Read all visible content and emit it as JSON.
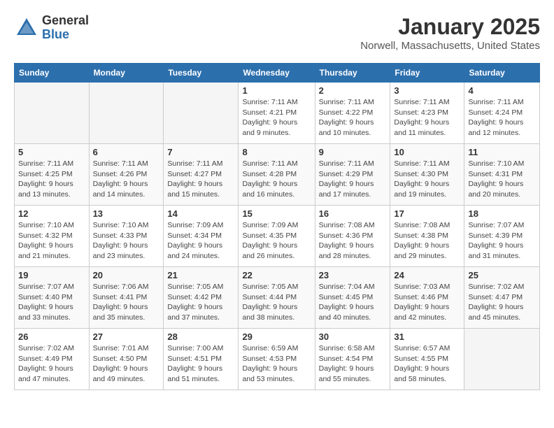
{
  "logo": {
    "general": "General",
    "blue": "Blue"
  },
  "title": "January 2025",
  "location": "Norwell, Massachusetts, United States",
  "days_of_week": [
    "Sunday",
    "Monday",
    "Tuesday",
    "Wednesday",
    "Thursday",
    "Friday",
    "Saturday"
  ],
  "weeks": [
    [
      {
        "day": "",
        "content": ""
      },
      {
        "day": "",
        "content": ""
      },
      {
        "day": "",
        "content": ""
      },
      {
        "day": "1",
        "content": "Sunrise: 7:11 AM\nSunset: 4:21 PM\nDaylight: 9 hours and 9 minutes."
      },
      {
        "day": "2",
        "content": "Sunrise: 7:11 AM\nSunset: 4:22 PM\nDaylight: 9 hours and 10 minutes."
      },
      {
        "day": "3",
        "content": "Sunrise: 7:11 AM\nSunset: 4:23 PM\nDaylight: 9 hours and 11 minutes."
      },
      {
        "day": "4",
        "content": "Sunrise: 7:11 AM\nSunset: 4:24 PM\nDaylight: 9 hours and 12 minutes."
      }
    ],
    [
      {
        "day": "5",
        "content": "Sunrise: 7:11 AM\nSunset: 4:25 PM\nDaylight: 9 hours and 13 minutes."
      },
      {
        "day": "6",
        "content": "Sunrise: 7:11 AM\nSunset: 4:26 PM\nDaylight: 9 hours and 14 minutes."
      },
      {
        "day": "7",
        "content": "Sunrise: 7:11 AM\nSunset: 4:27 PM\nDaylight: 9 hours and 15 minutes."
      },
      {
        "day": "8",
        "content": "Sunrise: 7:11 AM\nSunset: 4:28 PM\nDaylight: 9 hours and 16 minutes."
      },
      {
        "day": "9",
        "content": "Sunrise: 7:11 AM\nSunset: 4:29 PM\nDaylight: 9 hours and 17 minutes."
      },
      {
        "day": "10",
        "content": "Sunrise: 7:11 AM\nSunset: 4:30 PM\nDaylight: 9 hours and 19 minutes."
      },
      {
        "day": "11",
        "content": "Sunrise: 7:10 AM\nSunset: 4:31 PM\nDaylight: 9 hours and 20 minutes."
      }
    ],
    [
      {
        "day": "12",
        "content": "Sunrise: 7:10 AM\nSunset: 4:32 PM\nDaylight: 9 hours and 21 minutes."
      },
      {
        "day": "13",
        "content": "Sunrise: 7:10 AM\nSunset: 4:33 PM\nDaylight: 9 hours and 23 minutes."
      },
      {
        "day": "14",
        "content": "Sunrise: 7:09 AM\nSunset: 4:34 PM\nDaylight: 9 hours and 24 minutes."
      },
      {
        "day": "15",
        "content": "Sunrise: 7:09 AM\nSunset: 4:35 PM\nDaylight: 9 hours and 26 minutes."
      },
      {
        "day": "16",
        "content": "Sunrise: 7:08 AM\nSunset: 4:36 PM\nDaylight: 9 hours and 28 minutes."
      },
      {
        "day": "17",
        "content": "Sunrise: 7:08 AM\nSunset: 4:38 PM\nDaylight: 9 hours and 29 minutes."
      },
      {
        "day": "18",
        "content": "Sunrise: 7:07 AM\nSunset: 4:39 PM\nDaylight: 9 hours and 31 minutes."
      }
    ],
    [
      {
        "day": "19",
        "content": "Sunrise: 7:07 AM\nSunset: 4:40 PM\nDaylight: 9 hours and 33 minutes."
      },
      {
        "day": "20",
        "content": "Sunrise: 7:06 AM\nSunset: 4:41 PM\nDaylight: 9 hours and 35 minutes."
      },
      {
        "day": "21",
        "content": "Sunrise: 7:05 AM\nSunset: 4:42 PM\nDaylight: 9 hours and 37 minutes."
      },
      {
        "day": "22",
        "content": "Sunrise: 7:05 AM\nSunset: 4:44 PM\nDaylight: 9 hours and 38 minutes."
      },
      {
        "day": "23",
        "content": "Sunrise: 7:04 AM\nSunset: 4:45 PM\nDaylight: 9 hours and 40 minutes."
      },
      {
        "day": "24",
        "content": "Sunrise: 7:03 AM\nSunset: 4:46 PM\nDaylight: 9 hours and 42 minutes."
      },
      {
        "day": "25",
        "content": "Sunrise: 7:02 AM\nSunset: 4:47 PM\nDaylight: 9 hours and 45 minutes."
      }
    ],
    [
      {
        "day": "26",
        "content": "Sunrise: 7:02 AM\nSunset: 4:49 PM\nDaylight: 9 hours and 47 minutes."
      },
      {
        "day": "27",
        "content": "Sunrise: 7:01 AM\nSunset: 4:50 PM\nDaylight: 9 hours and 49 minutes."
      },
      {
        "day": "28",
        "content": "Sunrise: 7:00 AM\nSunset: 4:51 PM\nDaylight: 9 hours and 51 minutes."
      },
      {
        "day": "29",
        "content": "Sunrise: 6:59 AM\nSunset: 4:53 PM\nDaylight: 9 hours and 53 minutes."
      },
      {
        "day": "30",
        "content": "Sunrise: 6:58 AM\nSunset: 4:54 PM\nDaylight: 9 hours and 55 minutes."
      },
      {
        "day": "31",
        "content": "Sunrise: 6:57 AM\nSunset: 4:55 PM\nDaylight: 9 hours and 58 minutes."
      },
      {
        "day": "",
        "content": ""
      }
    ]
  ]
}
